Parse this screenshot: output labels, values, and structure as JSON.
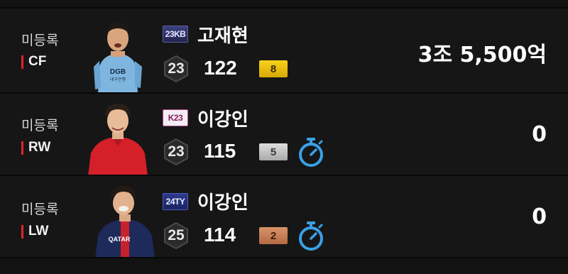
{
  "players": [
    {
      "status": "미등록",
      "position": "CF",
      "season": "23KB",
      "name": "고재현",
      "level": "23",
      "ovr": "122",
      "grade": "8",
      "grade_color": "gold",
      "has_timer": false,
      "price": "3조 5,500억"
    },
    {
      "status": "미등록",
      "position": "RW",
      "season": "K23",
      "name": "이강인",
      "level": "23",
      "ovr": "115",
      "grade": "5",
      "grade_color": "silver",
      "has_timer": true,
      "price": "0"
    },
    {
      "status": "미등록",
      "position": "LW",
      "season": "24TY",
      "name": "이강인",
      "level": "25",
      "ovr": "114",
      "grade": "2",
      "grade_color": "bronze",
      "has_timer": true,
      "price": "0"
    }
  ],
  "colors": {
    "background": "#121212",
    "accent_red": "#e2232a",
    "timer_blue": "#3aa0e6"
  }
}
